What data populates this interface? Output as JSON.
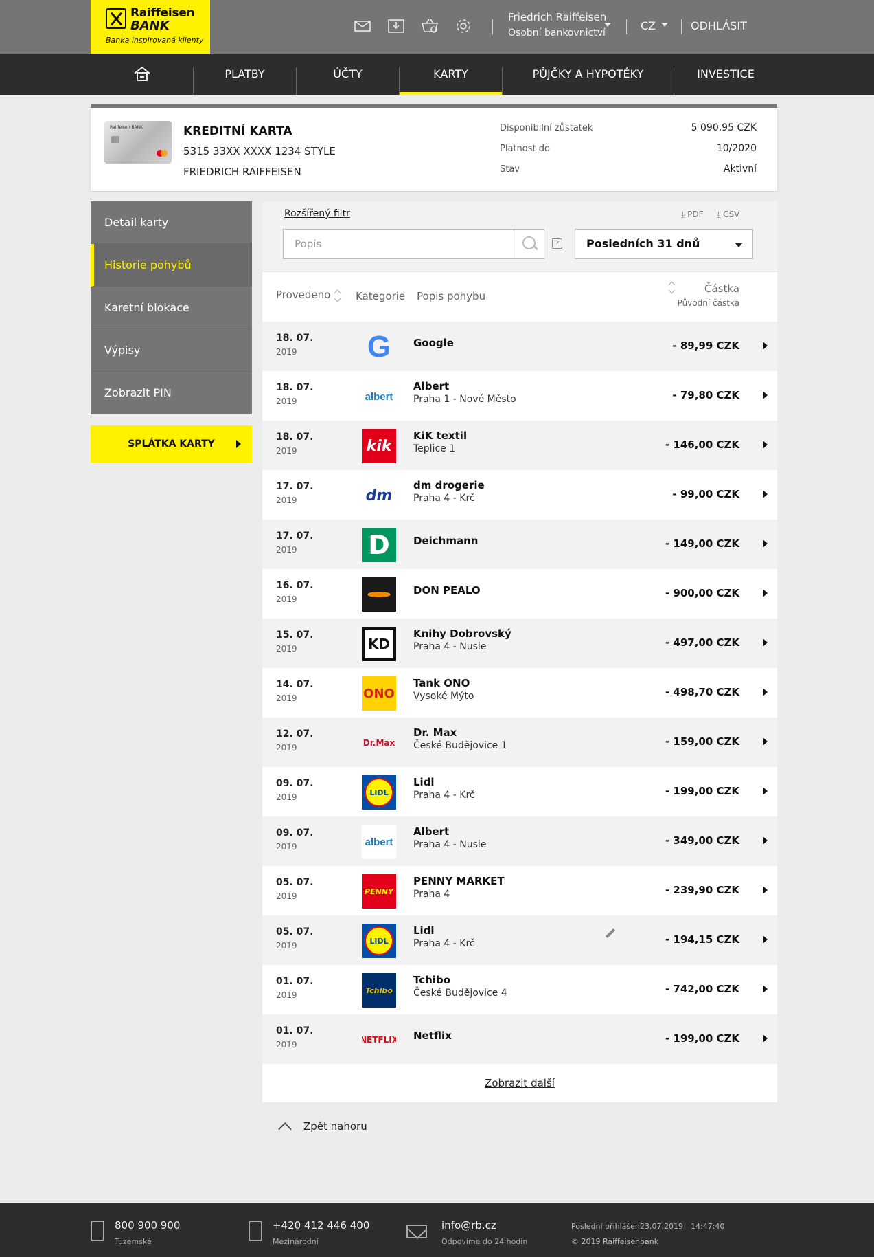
{
  "brand": {
    "name_line1": "Raiffeisen",
    "name_line2": "BANK",
    "tagline": "Banka inspirovaná klienty"
  },
  "header": {
    "icons": [
      "mail-icon",
      "download-icon",
      "basket-icon",
      "settings-icon"
    ],
    "user_name": "Friedrich Raiffeisen",
    "user_segment": "Osobní bankovnictví",
    "lang": "CZ",
    "logout": "ODHLÁSIT"
  },
  "nav": {
    "items": [
      {
        "label": "PLATBY"
      },
      {
        "label": "ÚČTY"
      },
      {
        "label": "KARTY"
      },
      {
        "label": "PŮJČKY A HYPOTÉKY"
      },
      {
        "label": "INVESTICE"
      }
    ],
    "active": "KARTY"
  },
  "card": {
    "title": "KREDITNÍ KARTA",
    "number": "5315 33XX XXXX 1234 STYLE",
    "holder": "FRIEDRICH RAIFFEISEN",
    "image_label": "Raiffeisen BANK",
    "details": [
      {
        "label": "Disponibilní zůstatek",
        "value": "5 090,95 CZK"
      },
      {
        "label": "Platnost do",
        "value": "10/2020"
      },
      {
        "label": "Stav",
        "value": "Aktivní"
      }
    ]
  },
  "sidebar": {
    "items": [
      {
        "label": "Detail karty"
      },
      {
        "label": "Historie pohybů"
      },
      {
        "label": "Karetní blokace"
      },
      {
        "label": "Výpisy"
      },
      {
        "label": "Zobrazit PIN"
      }
    ],
    "active": "Historie pohybů",
    "cta": "SPLÁTKA KARTY"
  },
  "filter": {
    "advanced": "Rozšířený filtr",
    "pdf": "PDF",
    "csv": "CSV",
    "search_placeholder": "Popis",
    "help": "?",
    "period": "Posledních 31 dnů"
  },
  "table": {
    "headers": {
      "date": "Provedeno",
      "category": "Kategorie",
      "description": "Popis pohybu",
      "amount": "Částka",
      "amount_sub": "Původní částka"
    },
    "rows": [
      {
        "date": "18. 07.",
        "year": "2019",
        "name": "Google",
        "place": "",
        "amount": "- 89,99 CZK",
        "logo": "google-logo-icon",
        "logo_text": "G"
      },
      {
        "date": "18. 07.",
        "year": "2019",
        "name": "Albert",
        "place": "Praha 1 - Nové Město",
        "amount": "- 79,80 CZK",
        "logo": "albert-logo-icon",
        "logo_text": "albert"
      },
      {
        "date": "18. 07.",
        "year": "2019",
        "name": "KiK textil",
        "place": "Teplice 1",
        "amount": "- 146,00 CZK",
        "logo": "kik-logo-icon",
        "logo_text": "kik"
      },
      {
        "date": "17. 07.",
        "year": "2019",
        "name": "dm drogerie",
        "place": "Praha 4 - Krč",
        "amount": "- 99,00 CZK",
        "logo": "dm-logo-icon",
        "logo_text": "dm"
      },
      {
        "date": "17. 07.",
        "year": "2019",
        "name": "Deichmann",
        "place": "",
        "amount": "- 149,00 CZK",
        "logo": "deichmann-logo-icon",
        "logo_text": "D"
      },
      {
        "date": "16. 07.",
        "year": "2019",
        "name": "DON PEALO",
        "place": "",
        "amount": "- 900,00 CZK",
        "logo": "don-pealo-logo-icon",
        "logo_text": ""
      },
      {
        "date": "15. 07.",
        "year": "2019",
        "name": "Knihy Dobrovský",
        "place": "Praha 4 - Nusle",
        "amount": "- 497,00 CZK",
        "logo": "knihy-dobrovsky-logo-icon",
        "logo_text": "KD"
      },
      {
        "date": "14. 07.",
        "year": "2019",
        "name": "Tank ONO",
        "place": "Vysoké Mýto",
        "amount": "- 498,70 CZK",
        "logo": "ono-logo-icon",
        "logo_text": "ONO"
      },
      {
        "date": "12. 07.",
        "year": "2019",
        "name": "Dr. Max",
        "place": "České Budějovice 1",
        "amount": "- 159,00 CZK",
        "logo": "drmax-logo-icon",
        "logo_text": "Dr.Max"
      },
      {
        "date": "09. 07.",
        "year": "2019",
        "name": "Lidl",
        "place": "Praha 4 - Krč",
        "amount": "- 199,00 CZK",
        "logo": "lidl-logo-icon",
        "logo_text": "LIDL"
      },
      {
        "date": "09. 07.",
        "year": "2019",
        "name": "Albert",
        "place": "Praha 4 - Nusle",
        "amount": "- 349,00 CZK",
        "logo": "albert-logo-icon",
        "logo_text": "albert"
      },
      {
        "date": "05. 07.",
        "year": "2019",
        "name": "PENNY MARKET",
        "place": "Praha 4",
        "amount": "- 239,90 CZK",
        "logo": "penny-logo-icon",
        "logo_text": "PENNY"
      },
      {
        "date": "05. 07.",
        "year": "2019",
        "name": "Lidl",
        "place": "Praha 4 - Krč",
        "amount": "- 194,15 CZK",
        "logo": "lidl-logo-icon",
        "logo_text": "LIDL",
        "edit": true
      },
      {
        "date": "01. 07.",
        "year": "2019",
        "name": "Tchibo",
        "place": "České Budějovice 4",
        "amount": "- 742,00 CZK",
        "logo": "tchibo-logo-icon",
        "logo_text": "Tchibo"
      },
      {
        "date": "01. 07.",
        "year": "2019",
        "name": "Netflix",
        "place": "",
        "amount": "- 199,00 CZK",
        "logo": "netflix-logo-icon",
        "logo_text": "NETFLIX"
      }
    ],
    "show_more": "Zobrazit další"
  },
  "back_to_top": "Zpět nahoru",
  "footer": {
    "phone1": "800 900 900",
    "phone1_sub": "Tuzemské",
    "phone2": "+420 412 446 400",
    "phone2_sub": "Mezinárodní",
    "email": "info@rb.cz",
    "email_sub": "Odpovíme do 24 hodin",
    "last_login_label": "Poslední přihlášení",
    "last_login_date": "23.07.2019",
    "last_login_time": "14:47:40",
    "copyright": "© 2019 Raiffeisenbank"
  },
  "colors": {
    "brand_yellow": "#fff200",
    "nav_dark": "#2d2d2d",
    "top_gray": "#757575"
  }
}
